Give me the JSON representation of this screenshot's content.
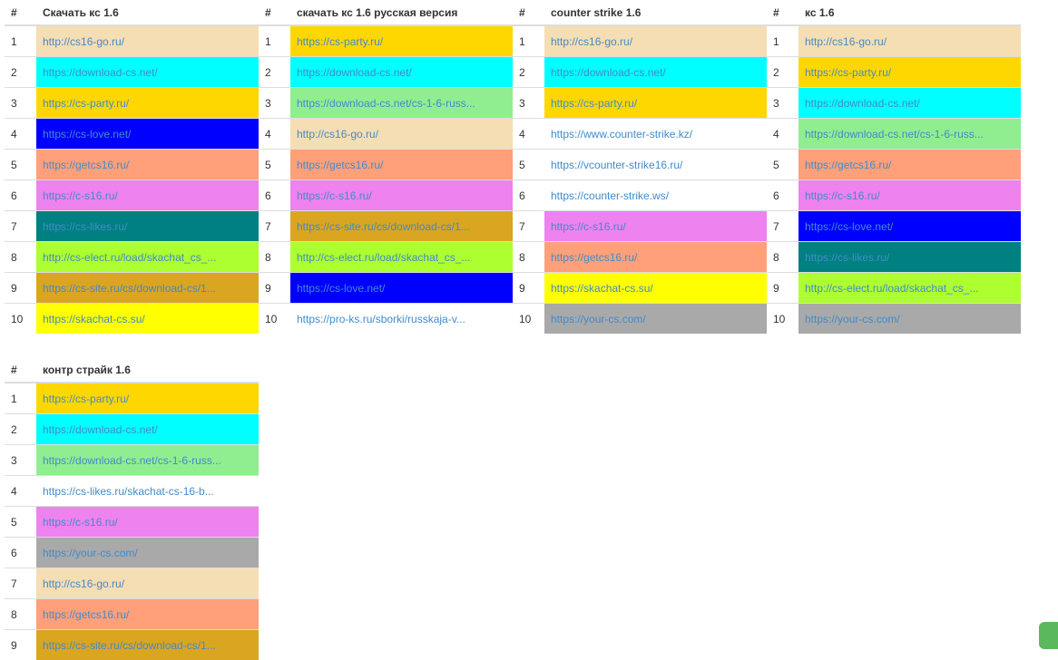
{
  "tables": [
    {
      "index_header": "#",
      "query": "Скачать кс 1.6",
      "rows": [
        {
          "n": "1",
          "url": "http://cs16-go.ru/",
          "bg": "#F5DEB3"
        },
        {
          "n": "2",
          "url": "https://download-cs.net/",
          "bg": "#00FFFF"
        },
        {
          "n": "3",
          "url": "https://cs-party.ru/",
          "bg": "#FFD700"
        },
        {
          "n": "4",
          "url": "https://cs-love.net/",
          "bg": "#0000FF"
        },
        {
          "n": "5",
          "url": "https://getcs16.ru/",
          "bg": "#FFA07A"
        },
        {
          "n": "6",
          "url": "https://c-s16.ru/",
          "bg": "#EE82EE"
        },
        {
          "n": "7",
          "url": "https://cs-likes.ru/",
          "bg": "#008080"
        },
        {
          "n": "8",
          "url": "http://cs-elect.ru/load/skachat_cs_...",
          "bg": "#ADFF2F"
        },
        {
          "n": "9",
          "url": "https://cs-site.ru/cs/download-cs/1...",
          "bg": "#DAA520"
        },
        {
          "n": "10",
          "url": "https://skachat-cs.su/",
          "bg": "#FFFF00"
        }
      ]
    },
    {
      "index_header": "#",
      "query": "скачать кс 1.6 русская версия",
      "rows": [
        {
          "n": "1",
          "url": "https://cs-party.ru/",
          "bg": "#FFD700"
        },
        {
          "n": "2",
          "url": "https://download-cs.net/",
          "bg": "#00FFFF"
        },
        {
          "n": "3",
          "url": "https://download-cs.net/cs-1-6-russ...",
          "bg": "#90EE90"
        },
        {
          "n": "4",
          "url": "http://cs16-go.ru/",
          "bg": "#F5DEB3"
        },
        {
          "n": "5",
          "url": "https://getcs16.ru/",
          "bg": "#FFA07A"
        },
        {
          "n": "6",
          "url": "https://c-s16.ru/",
          "bg": "#EE82EE"
        },
        {
          "n": "7",
          "url": "https://cs-site.ru/cs/download-cs/1...",
          "bg": "#DAA520"
        },
        {
          "n": "8",
          "url": "http://cs-elect.ru/load/skachat_cs_...",
          "bg": "#ADFF2F"
        },
        {
          "n": "9",
          "url": "https://cs-love.net/",
          "bg": "#0000FF"
        },
        {
          "n": "10",
          "url": "https://pro-ks.ru/sborki/russkaja-v...",
          "bg": ""
        }
      ]
    },
    {
      "index_header": "#",
      "query": "counter strike 1.6",
      "rows": [
        {
          "n": "1",
          "url": "http://cs16-go.ru/",
          "bg": "#F5DEB3"
        },
        {
          "n": "2",
          "url": "https://download-cs.net/",
          "bg": "#00FFFF"
        },
        {
          "n": "3",
          "url": "https://cs-party.ru/",
          "bg": "#FFD700"
        },
        {
          "n": "4",
          "url": "https://www.counter-strike.kz/",
          "bg": ""
        },
        {
          "n": "5",
          "url": "https://vcounter-strike16.ru/",
          "bg": ""
        },
        {
          "n": "6",
          "url": "https://counter-strike.ws/",
          "bg": ""
        },
        {
          "n": "7",
          "url": "https://c-s16.ru/",
          "bg": "#EE82EE"
        },
        {
          "n": "8",
          "url": "https://getcs16.ru/",
          "bg": "#FFA07A"
        },
        {
          "n": "9",
          "url": "https://skachat-cs.su/",
          "bg": "#FFFF00"
        },
        {
          "n": "10",
          "url": "https://your-cs.com/",
          "bg": "#A9A9A9"
        }
      ]
    },
    {
      "index_header": "#",
      "query": "кс 1.6",
      "rows": [
        {
          "n": "1",
          "url": "http://cs16-go.ru/",
          "bg": "#F5DEB3"
        },
        {
          "n": "2",
          "url": "https://cs-party.ru/",
          "bg": "#FFD700"
        },
        {
          "n": "3",
          "url": "https://download-cs.net/",
          "bg": "#00FFFF"
        },
        {
          "n": "4",
          "url": "https://download-cs.net/cs-1-6-russ...",
          "bg": "#90EE90"
        },
        {
          "n": "5",
          "url": "https://getcs16.ru/",
          "bg": "#FFA07A"
        },
        {
          "n": "6",
          "url": "https://c-s16.ru/",
          "bg": "#EE82EE"
        },
        {
          "n": "7",
          "url": "https://cs-love.net/",
          "bg": "#0000FF"
        },
        {
          "n": "8",
          "url": "https://cs-likes.ru/",
          "bg": "#008080"
        },
        {
          "n": "9",
          "url": "http://cs-elect.ru/load/skachat_cs_...",
          "bg": "#ADFF2F"
        },
        {
          "n": "10",
          "url": "https://your-cs.com/",
          "bg": "#A9A9A9"
        }
      ]
    },
    {
      "index_header": "#",
      "query": "контр страйк 1.6",
      "rows": [
        {
          "n": "1",
          "url": "https://cs-party.ru/",
          "bg": "#FFD700"
        },
        {
          "n": "2",
          "url": "https://download-cs.net/",
          "bg": "#00FFFF"
        },
        {
          "n": "3",
          "url": "https://download-cs.net/cs-1-6-russ...",
          "bg": "#90EE90"
        },
        {
          "n": "4",
          "url": "https://cs-likes.ru/skachat-cs-16-b...",
          "bg": ""
        },
        {
          "n": "5",
          "url": "https://c-s16.ru/",
          "bg": "#EE82EE"
        },
        {
          "n": "6",
          "url": "https://your-cs.com/",
          "bg": "#A9A9A9"
        },
        {
          "n": "7",
          "url": "http://cs16-go.ru/",
          "bg": "#F5DEB3"
        },
        {
          "n": "8",
          "url": "https://getcs16.ru/",
          "bg": "#FFA07A"
        },
        {
          "n": "9",
          "url": "https://cs-site.ru/cs/download-cs/1...",
          "bg": "#DAA520"
        }
      ]
    }
  ],
  "colors": {
    "link": "#428bca",
    "border": "#dddddd",
    "chat_widget": "#5cb85c"
  }
}
